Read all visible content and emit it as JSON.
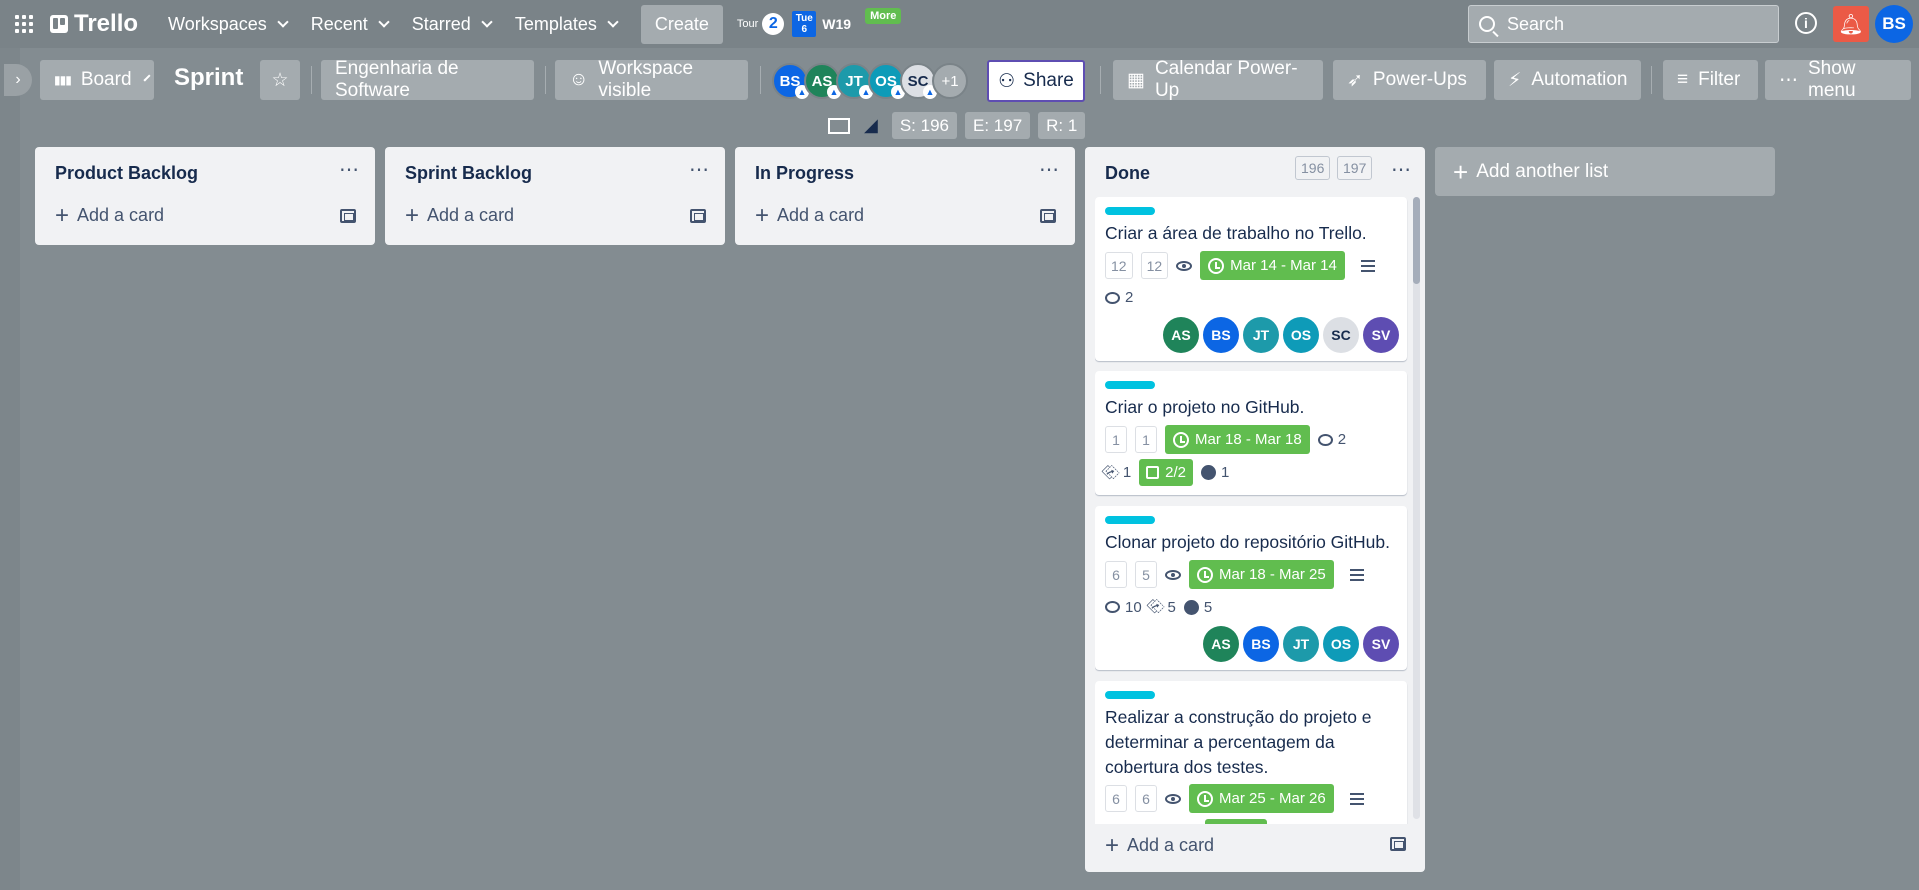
{
  "header": {
    "brand": "Trello",
    "nav": [
      "Workspaces",
      "Recent",
      "Starred",
      "Templates"
    ],
    "create_label": "Create",
    "tour_label": "Tour",
    "tour_badge": "2",
    "calendar_day": "Tue",
    "calendar_date": "6",
    "week_label": "W19",
    "more_label": "More",
    "search_placeholder": "Search",
    "user_initials": "BS"
  },
  "board": {
    "view_label": "Board",
    "title": "Sprint",
    "workspace_name": "Engenharia de Software",
    "visibility_label": "Workspace visible",
    "members": [
      {
        "initials": "BS",
        "color": "#0c66e4"
      },
      {
        "initials": "AS",
        "color": "#1f845a"
      },
      {
        "initials": "JT",
        "color": "#1d9aaa"
      },
      {
        "initials": "OS",
        "color": "#0e9bb8"
      },
      {
        "initials": "SC",
        "color": "#dcdfe4"
      }
    ],
    "members_extra": "+1",
    "share_label": "Share",
    "calendar_powerup_label": "Calendar Power-Up",
    "powerups_label": "Power-Ups",
    "automation_label": "Automation",
    "filter_label": "Filter",
    "show_menu_label": "Show menu",
    "stats": {
      "s": "S: 196",
      "e": "E: 197",
      "r": "R: 1"
    }
  },
  "lists": [
    {
      "title": "Product Backlog",
      "add_card_label": "Add a card"
    },
    {
      "title": "Sprint Backlog",
      "add_card_label": "Add a card"
    },
    {
      "title": "In Progress",
      "add_card_label": "Add a card"
    },
    {
      "title": "Done",
      "add_card_label": "Add a card",
      "count_a": "196",
      "count_b": "197"
    }
  ],
  "add_list_label": "Add another list",
  "cards": [
    {
      "title": "Criar a área de trabalho no Trello.",
      "est_a": "12",
      "est_b": "12",
      "due": "Mar 14 - Mar 14",
      "comments": "2",
      "members": [
        {
          "initials": "AS",
          "color": "#1f845a"
        },
        {
          "initials": "BS",
          "color": "#0c66e4"
        },
        {
          "initials": "JT",
          "color": "#1d9aaa"
        },
        {
          "initials": "OS",
          "color": "#0e9bb8"
        },
        {
          "initials": "SC",
          "color": "#dcdfe4"
        },
        {
          "initials": "SV",
          "color": "#5e4db2"
        }
      ]
    },
    {
      "title": "Criar o projeto no GitHub.",
      "est_a": "1",
      "est_b": "1",
      "due": "Mar 18 - Mar 18",
      "comments": "2",
      "attachments": "1",
      "checklist": "2/2",
      "github": "1"
    },
    {
      "title": "Clonar projeto do repositório GitHub.",
      "est_a": "6",
      "est_b": "5",
      "due": "Mar 18 - Mar 25",
      "comments": "10",
      "attachments": "5",
      "github": "5",
      "members": [
        {
          "initials": "AS",
          "color": "#1f845a"
        },
        {
          "initials": "BS",
          "color": "#0c66e4"
        },
        {
          "initials": "JT",
          "color": "#1d9aaa"
        },
        {
          "initials": "OS",
          "color": "#0e9bb8"
        },
        {
          "initials": "SV",
          "color": "#5e4db2"
        }
      ]
    },
    {
      "title": "Realizar a construção do projeto e determinar a percentagem da cobertura dos testes.",
      "est_a": "6",
      "est_b": "6",
      "due": "Mar 25 - Mar 26"
    }
  ]
}
